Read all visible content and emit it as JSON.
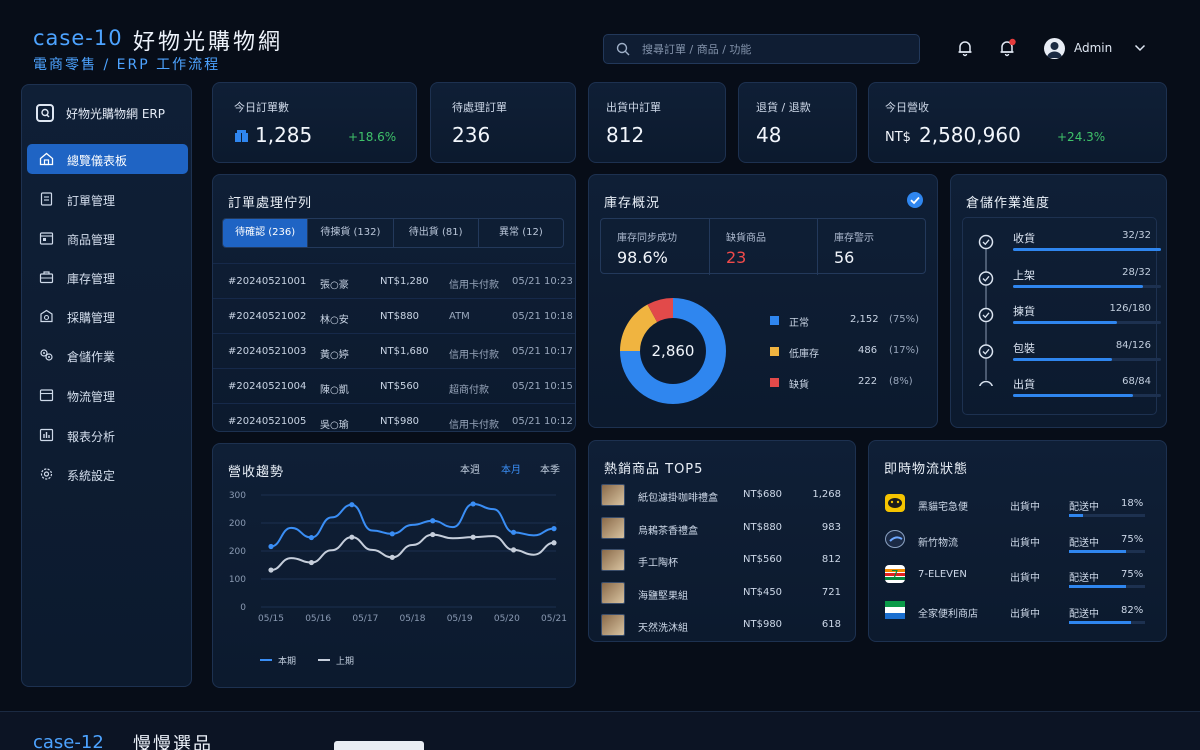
{
  "header": {
    "case_id": "case-10",
    "app_name": "好物光購物網",
    "subtitle": "電商零售 / ERP 工作流程",
    "search_placeholder": "搜尋訂單 / 商品 / 功能",
    "user_name": "Admin"
  },
  "sidebar": {
    "brand": "好物光購物網 ERP",
    "items": [
      {
        "label": "總覽儀表板",
        "icon": "dashboard-icon",
        "active": true
      },
      {
        "label": "訂單管理",
        "icon": "document-icon"
      },
      {
        "label": "商品管理",
        "icon": "calendar-icon"
      },
      {
        "label": "庫存管理",
        "icon": "briefcase-icon"
      },
      {
        "label": "採購管理",
        "icon": "cart-icon"
      },
      {
        "label": "倉儲作業",
        "icon": "gear-cluster-icon"
      },
      {
        "label": "物流管理",
        "icon": "box-icon"
      },
      {
        "label": "報表分析",
        "icon": "chart-icon"
      },
      {
        "label": "系統設定",
        "icon": "settings-icon"
      }
    ]
  },
  "kpis": [
    {
      "label": "今日訂單數",
      "value": "1,285",
      "delta": "+18.6%"
    },
    {
      "label": "待處理訂單",
      "value": "236"
    },
    {
      "label": "出貨中訂單",
      "value": "812"
    },
    {
      "label": "退貨 / 退款",
      "value": "48"
    },
    {
      "label": "今日營收",
      "value_prefix": "NT$",
      "value": "2,580,960",
      "delta": "+24.3%"
    }
  ],
  "order_queue": {
    "title": "訂單處理佇列",
    "tabs": [
      "待確認 (236)",
      "待揀貨 (132)",
      "待出貨 (81)",
      "異常 (12)"
    ],
    "rows": [
      {
        "id": "#20240521001",
        "name": "張○豪",
        "amount": "NT$1,280",
        "payment": "信用卡付款",
        "time": "05/21 10:23"
      },
      {
        "id": "#20240521002",
        "name": "林○安",
        "amount": "NT$880",
        "payment": "ATM",
        "time": "05/21 10:18"
      },
      {
        "id": "#20240521003",
        "name": "黃○婷",
        "amount": "NT$1,680",
        "payment": "信用卡付款",
        "time": "05/21 10:17"
      },
      {
        "id": "#20240521004",
        "name": "陳○凱",
        "amount": "NT$560",
        "payment": "超商付款",
        "time": "05/21 10:15"
      },
      {
        "id": "#20240521005",
        "name": "吳○瑜",
        "amount": "NT$980",
        "payment": "信用卡付款",
        "time": "05/21 10:12"
      }
    ]
  },
  "inventory": {
    "title": "庫存概況",
    "stats": [
      {
        "label": "庫存同步成功",
        "value": "98.6%"
      },
      {
        "label": "缺貨商品",
        "value": "23"
      },
      {
        "label": "庫存警示",
        "value": "56"
      }
    ],
    "donut_total": "2,860",
    "colors": {
      "normal": "#2f86ef",
      "low": "#f0b440",
      "out": "#e24a4a"
    },
    "legend": [
      {
        "label": "正常",
        "count": "2,152",
        "pct": "(75%)",
        "share": 75
      },
      {
        "label": "低庫存",
        "count": "486",
        "pct": "(17%)",
        "share": 17
      },
      {
        "label": "缺貨",
        "count": "222",
        "pct": "(8%)",
        "share": 8
      }
    ]
  },
  "warehouse": {
    "title": "倉儲作業進度",
    "steps": [
      {
        "label": "收貨",
        "count": "32/32",
        "progress": 1.0
      },
      {
        "label": "上架",
        "count": "28/32",
        "progress": 0.875
      },
      {
        "label": "揀貨",
        "count": "126/180",
        "progress": 0.7
      },
      {
        "label": "包裝",
        "count": "84/126",
        "progress": 0.667
      },
      {
        "label": "出貨",
        "count": "68/84",
        "progress": 0.81
      }
    ]
  },
  "revenue": {
    "title": "營收趨勢",
    "periods": [
      "本週",
      "本月",
      "本季"
    ],
    "active_period": "本月"
  },
  "chart_data": {
    "type": "line",
    "x": [
      "05/15",
      "05/16",
      "05/17",
      "05/18",
      "05/19",
      "05/20",
      "05/21"
    ],
    "ylim": [
      0,
      300
    ],
    "yticks": [
      "300",
      "200",
      "200",
      "100",
      "0"
    ],
    "series": [
      {
        "name": "本期",
        "color": "#3a8ef5",
        "values": [
          162,
          212,
          186,
          240,
          274,
          205,
          196,
          220,
          231,
          214,
          276,
          262,
          200,
          192,
          210
        ]
      },
      {
        "name": "上期",
        "color": "#c6cedb",
        "values": [
          99,
          131,
          119,
          152,
          187,
          153,
          133,
          166,
          194,
          184,
          187,
          190,
          153,
          140,
          172
        ]
      }
    ],
    "legend_position": "bottom-center",
    "grid": true
  },
  "hot_products": {
    "title": "熱銷商品 TOP5",
    "rows": [
      {
        "name": "紙包濾掛咖啡禮盒",
        "price": "NT$680",
        "sales": "1,268"
      },
      {
        "name": "烏鶇茶香禮盒",
        "price": "NT$880",
        "sales": "983"
      },
      {
        "name": "手工陶杯",
        "price": "NT$560",
        "sales": "812"
      },
      {
        "name": "海鹽堅果組",
        "price": "NT$450",
        "sales": "721"
      },
      {
        "name": "天然洗沐組",
        "price": "NT$980",
        "sales": "618"
      }
    ]
  },
  "logistics": {
    "title": "即時物流狀態",
    "rows": [
      {
        "carrier": "黑貓宅急便",
        "status": "出貨中",
        "state": "配送中",
        "pct": "18%",
        "progress": 0.18
      },
      {
        "carrier": "新竹物流",
        "status": "出貨中",
        "state": "配送中",
        "pct": "75%",
        "progress": 0.75
      },
      {
        "carrier": "7-ELEVEN",
        "status": "出貨中",
        "state": "配送中",
        "pct": "75%",
        "progress": 0.75
      },
      {
        "carrier": "全家便利商店",
        "status": "出貨中",
        "state": "配送中",
        "pct": "82%",
        "progress": 0.82
      }
    ]
  },
  "next_case": {
    "case_id": "case-12",
    "name": "慢慢選品"
  }
}
